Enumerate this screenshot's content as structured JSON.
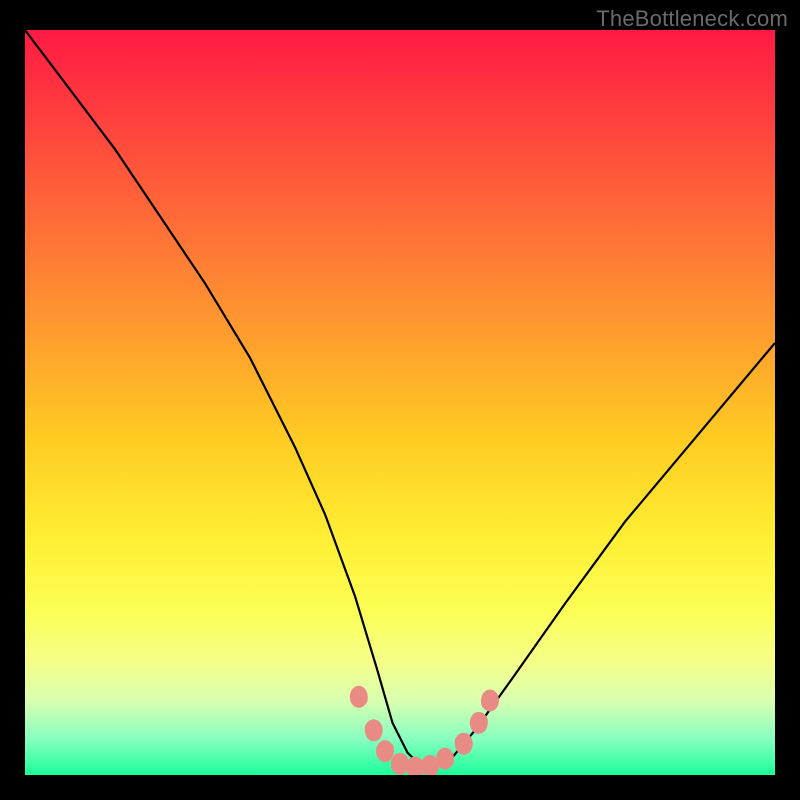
{
  "watermark": "TheBottleneck.com",
  "colors": {
    "frame": "#000000",
    "curve": "#000000",
    "marker_fill": "#e98b85",
    "marker_stroke": "#d46a64",
    "watermark": "#6a6a6a"
  },
  "chart_data": {
    "type": "line",
    "title": "",
    "xlabel": "",
    "ylabel": "",
    "xlim": [
      0,
      100
    ],
    "ylim": [
      0,
      100
    ],
    "grid": false,
    "legend": false,
    "annotations": [],
    "series": [
      {
        "name": "bottleneck-curve",
        "x": [
          0,
          6,
          12,
          18,
          24,
          30,
          36,
          40,
          44,
          47,
          49,
          51,
          53,
          55,
          57,
          60,
          65,
          72,
          80,
          90,
          100
        ],
        "values": [
          100,
          92,
          84,
          75,
          66,
          56,
          44,
          35,
          24,
          14,
          7,
          3,
          1,
          1.2,
          2.4,
          6,
          13,
          23,
          34,
          46,
          58
        ]
      }
    ],
    "markers": {
      "name": "highlighted-points",
      "points": [
        {
          "x": 44.5,
          "y": 10.5
        },
        {
          "x": 46.5,
          "y": 6.0
        },
        {
          "x": 48.0,
          "y": 3.2
        },
        {
          "x": 50.0,
          "y": 1.5
        },
        {
          "x": 52.0,
          "y": 1.0
        },
        {
          "x": 54.0,
          "y": 1.2
        },
        {
          "x": 56.0,
          "y": 2.2
        },
        {
          "x": 58.5,
          "y": 4.2
        },
        {
          "x": 60.5,
          "y": 7.0
        },
        {
          "x": 62.0,
          "y": 10.0
        }
      ]
    }
  }
}
